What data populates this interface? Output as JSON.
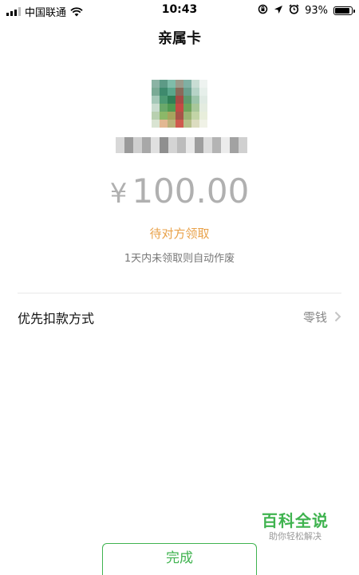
{
  "status_bar": {
    "carrier": "中国联通",
    "time": "10:43",
    "battery": "93%",
    "battery_level": 0.93,
    "signal_bars": 3
  },
  "nav": {
    "title": "亲属卡"
  },
  "recipient": {
    "avatar_colors": [
      [
        "#8bb3a4",
        "#5d9a86",
        "#7fbca9",
        "#9a9a8a",
        "#7fb0a3",
        "#c9ddd4",
        "#eef3f0"
      ],
      [
        "#7aaa95",
        "#3e8a6d",
        "#5aa68b",
        "#8a6a5a",
        "#6aa08e",
        "#b6d3c7",
        "#e6efea"
      ],
      [
        "#a5c8b8",
        "#4d9a73",
        "#2f7f56",
        "#a84a45",
        "#5e9a6e",
        "#9cc4aa",
        "#dfeae3"
      ],
      [
        "#c9dccf",
        "#6aa86a",
        "#4f9a52",
        "#c44a44",
        "#6ea45c",
        "#a8c79a",
        "#e4ece0"
      ],
      [
        "#b8d0b0",
        "#8cb868",
        "#a6a45e",
        "#a85448",
        "#9ab474",
        "#c2d4a6",
        "#e8eedb"
      ],
      [
        "#d9e4d2",
        "#e2b892",
        "#b9b27a",
        "#cf5a4e",
        "#b6c08a",
        "#dcdcc0",
        "#f0f2e6"
      ]
    ],
    "name_blur_colors": [
      "#d8d8d8",
      "#9a9a9a",
      "#cfcfcf",
      "#a8a8a8",
      "#e0e0e0",
      "#8f8f8f",
      "#d4d4d4",
      "#bcbcbc",
      "#e8e8e8",
      "#9e9e9e",
      "#dcdcdc",
      "#b4b4b4",
      "#ececec",
      "#a2a2a2",
      "#d0d0d0"
    ]
  },
  "amount": {
    "currency": "¥",
    "value": "100.00"
  },
  "status_text": "待对方领取",
  "expire_note": "1天内未领取则自动作废",
  "payment_row": {
    "label": "优先扣款方式",
    "value": "零钱"
  },
  "watermark": {
    "title": "百科全说",
    "subtitle": "助你轻松解决"
  },
  "done_button": {
    "label": "完成"
  },
  "colors": {
    "accent": "#3fb34f",
    "status": "#e9a24a",
    "amount": "#b0b0b0"
  }
}
